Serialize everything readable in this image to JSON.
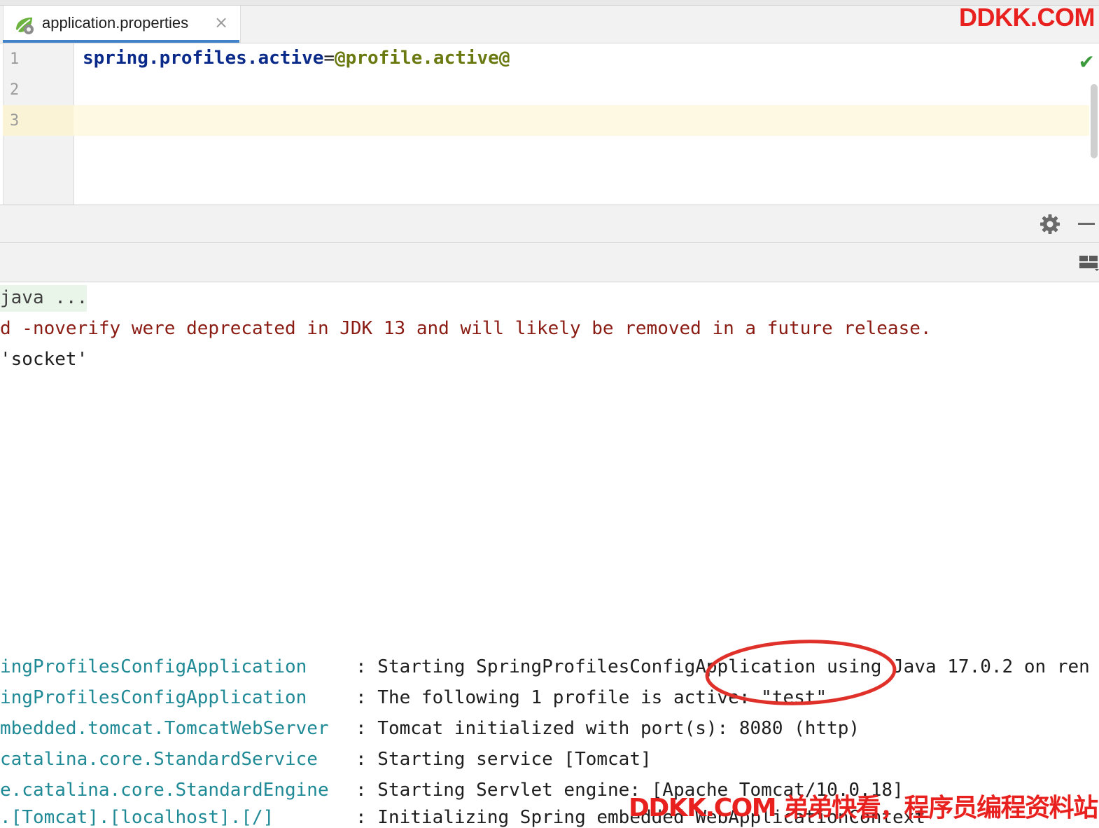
{
  "editor_tab": {
    "filename": "application.properties",
    "close_glyph": "×",
    "icon": "spring-leaf-icon"
  },
  "watermark_top": "DDKK.COM",
  "editor": {
    "line_numbers": [
      "1",
      "2",
      "3"
    ],
    "code_key": "spring.profiles.active",
    "code_eq": "=",
    "code_value": "@profile.active@",
    "status_icon": "check-icon"
  },
  "tool_window": {
    "settings_icon": "gear-icon",
    "minimize_icon": "minimize-icon",
    "layout_icon": "layout-icon"
  },
  "console": {
    "cmd_line": "java ...",
    "warning_line": "d -noverify were deprecated in JDK 13 and will likely be removed in a future release.",
    "socket_line": "'socket'",
    "log": [
      {
        "logger": "ingProfilesConfigApplication",
        "message": ": Starting SpringProfilesConfigApplication using Java 17.0.2 on ren"
      },
      {
        "logger": "ingProfilesConfigApplication",
        "message": ": The following 1 profile is active: \"test\""
      },
      {
        "logger": "mbedded.tomcat.TomcatWebServer",
        "message": ": Tomcat initialized with port(s): 8080 (http)"
      },
      {
        "logger": "catalina.core.StandardService",
        "message": ": Starting service [Tomcat]"
      },
      {
        "logger": "e.catalina.core.StandardEngine",
        "message": ": Starting Servlet engine: [Apache Tomcat/10.0.18]"
      },
      {
        "logger": ".[Tomcat].[localhost].[/]",
        "message": ": Initializing Spring embedded WebApplicationContext"
      }
    ]
  },
  "watermark_bottom": "DDKK.COM 弟弟快看，程序员编程资料站",
  "colors": {
    "accent_tab": "#4083c9",
    "watermark": "#e8201e",
    "annotation_circle": "#e0302a",
    "logger_teal": "#1f8a96",
    "warning_red": "#8a1c14"
  }
}
